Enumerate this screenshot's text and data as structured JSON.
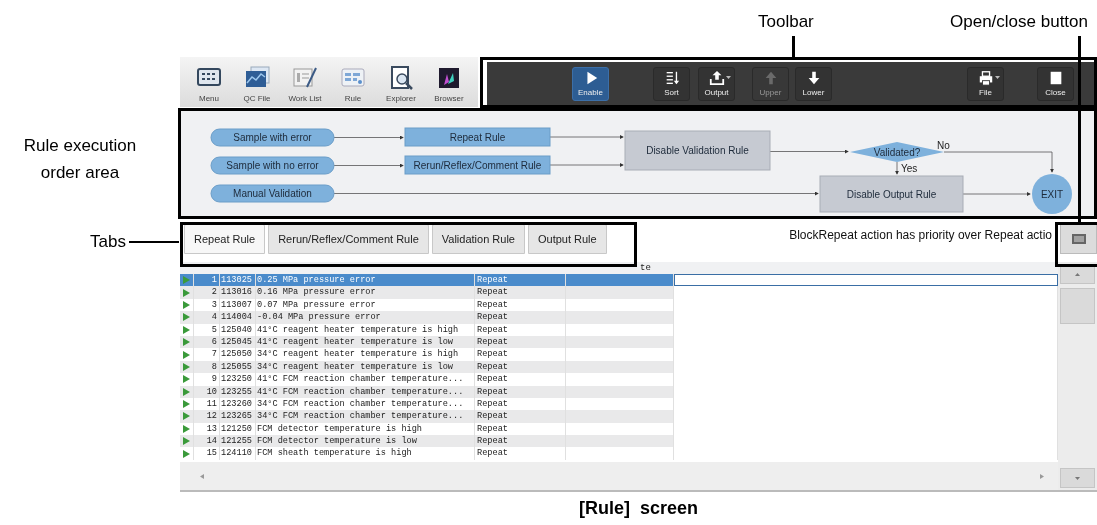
{
  "annotations": {
    "toolbar_label": "Toolbar",
    "open_close_label": "Open/close button",
    "order_area_label": "Rule execution order area",
    "tabs_label": "Tabs",
    "caption": "[Rule]  screen"
  },
  "nav": [
    {
      "label": "Menu"
    },
    {
      "label": "QC File"
    },
    {
      "label": "Work List"
    },
    {
      "label": "Rule"
    },
    {
      "label": "Explorer"
    },
    {
      "label": "Browser"
    }
  ],
  "toolbar": {
    "buttons": [
      {
        "label": "Enable",
        "selected": true,
        "disabled": false,
        "dropdown": false
      },
      {
        "label": "Sort",
        "selected": false,
        "disabled": false,
        "dropdown": false
      },
      {
        "label": "Output",
        "selected": false,
        "disabled": false,
        "dropdown": true
      },
      {
        "label": "Upper",
        "selected": false,
        "disabled": true,
        "dropdown": false
      },
      {
        "label": "Lower",
        "selected": false,
        "disabled": false,
        "dropdown": false
      },
      {
        "label": "File",
        "selected": false,
        "disabled": false,
        "dropdown": true
      },
      {
        "label": "Close",
        "selected": false,
        "disabled": false,
        "dropdown": false
      }
    ]
  },
  "flowchart": {
    "nodes": [
      {
        "kind": "start",
        "label": "Sample with error"
      },
      {
        "kind": "start",
        "label": "Sample with no error"
      },
      {
        "kind": "start",
        "label": "Manual Validation"
      },
      {
        "kind": "rule",
        "label": "Repeat Rule"
      },
      {
        "kind": "rule",
        "label": "Rerun/Reflex/Comment Rule"
      },
      {
        "kind": "process",
        "label": "Disable Validation Rule"
      },
      {
        "kind": "decision",
        "label": "Validated?"
      },
      {
        "kind": "process",
        "label": "Disable Output Rule"
      },
      {
        "kind": "exit",
        "label": "EXIT"
      }
    ],
    "branch_no": "No",
    "branch_yes": "Yes"
  },
  "tabs": [
    {
      "label": "Repeat Rule",
      "selected": true
    },
    {
      "label": "Rerun/Reflex/Comment Rule",
      "selected": false
    },
    {
      "label": "Validation Rule",
      "selected": false
    },
    {
      "label": "Output Rule",
      "selected": false
    }
  ],
  "notice": "BlockRepeat action has priority over Repeat actio",
  "table": {
    "header_fragment": "te",
    "rows": [
      {
        "no": "1",
        "code": "113025",
        "message": "0.25 MPa pressure error",
        "action": "Repeat",
        "selected": true
      },
      {
        "no": "2",
        "code": "113016",
        "message": "0.16 MPa pressure error",
        "action": "Repeat",
        "selected": false
      },
      {
        "no": "3",
        "code": "113007",
        "message": "0.07 MPa pressure error",
        "action": "Repeat",
        "selected": false
      },
      {
        "no": "4",
        "code": "114004",
        "message": "-0.04 MPa pressure error",
        "action": "Repeat",
        "selected": false
      },
      {
        "no": "5",
        "code": "125040",
        "message": "41°C reagent heater temperature is high",
        "action": "Repeat",
        "selected": false
      },
      {
        "no": "6",
        "code": "125045",
        "message": "41°C reagent heater temperature is low",
        "action": "Repeat",
        "selected": false
      },
      {
        "no": "7",
        "code": "125050",
        "message": "34°C reagent heater temperature is high",
        "action": "Repeat",
        "selected": false
      },
      {
        "no": "8",
        "code": "125055",
        "message": "34°C reagent heater temperature is low",
        "action": "Repeat",
        "selected": false
      },
      {
        "no": "9",
        "code": "123250",
        "message": "41°C FCM reaction chamber temperature...",
        "action": "Repeat",
        "selected": false
      },
      {
        "no": "10",
        "code": "123255",
        "message": "41°C FCM reaction chamber temperature...",
        "action": "Repeat",
        "selected": false
      },
      {
        "no": "11",
        "code": "123260",
        "message": "34°C FCM reaction chamber temperature...",
        "action": "Repeat",
        "selected": false
      },
      {
        "no": "12",
        "code": "123265",
        "message": "34°C FCM reaction chamber temperature...",
        "action": "Repeat",
        "selected": false
      },
      {
        "no": "13",
        "code": "121250",
        "message": "FCM detector temperature is high",
        "action": "Repeat",
        "selected": false
      },
      {
        "no": "14",
        "code": "121255",
        "message": "FCM detector temperature is low",
        "action": "Repeat",
        "selected": false
      },
      {
        "no": "15",
        "code": "124110",
        "message": "FCM sheath temperature is high",
        "action": "Repeat",
        "selected": false
      }
    ]
  }
}
